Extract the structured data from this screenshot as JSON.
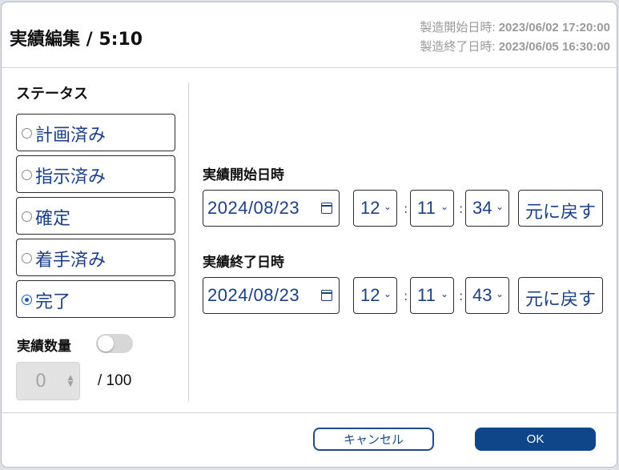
{
  "dialog": {
    "title": "実績編集 / 5:10",
    "production_start_label": "製造開始日時:",
    "production_start_value": "2023/06/02 17:20:00",
    "production_end_label": "製造終了日時:",
    "production_end_value": "2023/06/05 16:30:00"
  },
  "status": {
    "label": "ステータス",
    "options": [
      {
        "label": "計画済み",
        "selected": false
      },
      {
        "label": "指示済み",
        "selected": false
      },
      {
        "label": "確定",
        "selected": false
      },
      {
        "label": "着手済み",
        "selected": false
      },
      {
        "label": "完了",
        "selected": true
      }
    ]
  },
  "quantity": {
    "label": "実績数量",
    "toggle_on": false,
    "value": "0",
    "total": "/ 100"
  },
  "actual_start": {
    "label": "実績開始日時",
    "date": "2024/08/23",
    "hour": "12",
    "minute": "11",
    "second": "34",
    "reset_label": "元に戻す"
  },
  "actual_end": {
    "label": "実績終了日時",
    "date": "2024/08/23",
    "hour": "12",
    "minute": "11",
    "second": "43",
    "reset_label": "元に戻す"
  },
  "footer": {
    "cancel_label": "キャンセル",
    "ok_label": "OK"
  },
  "colors": {
    "accent": "#0f4589",
    "text_blue": "#1b3f8a",
    "radio_selected": "#1a56c8"
  }
}
